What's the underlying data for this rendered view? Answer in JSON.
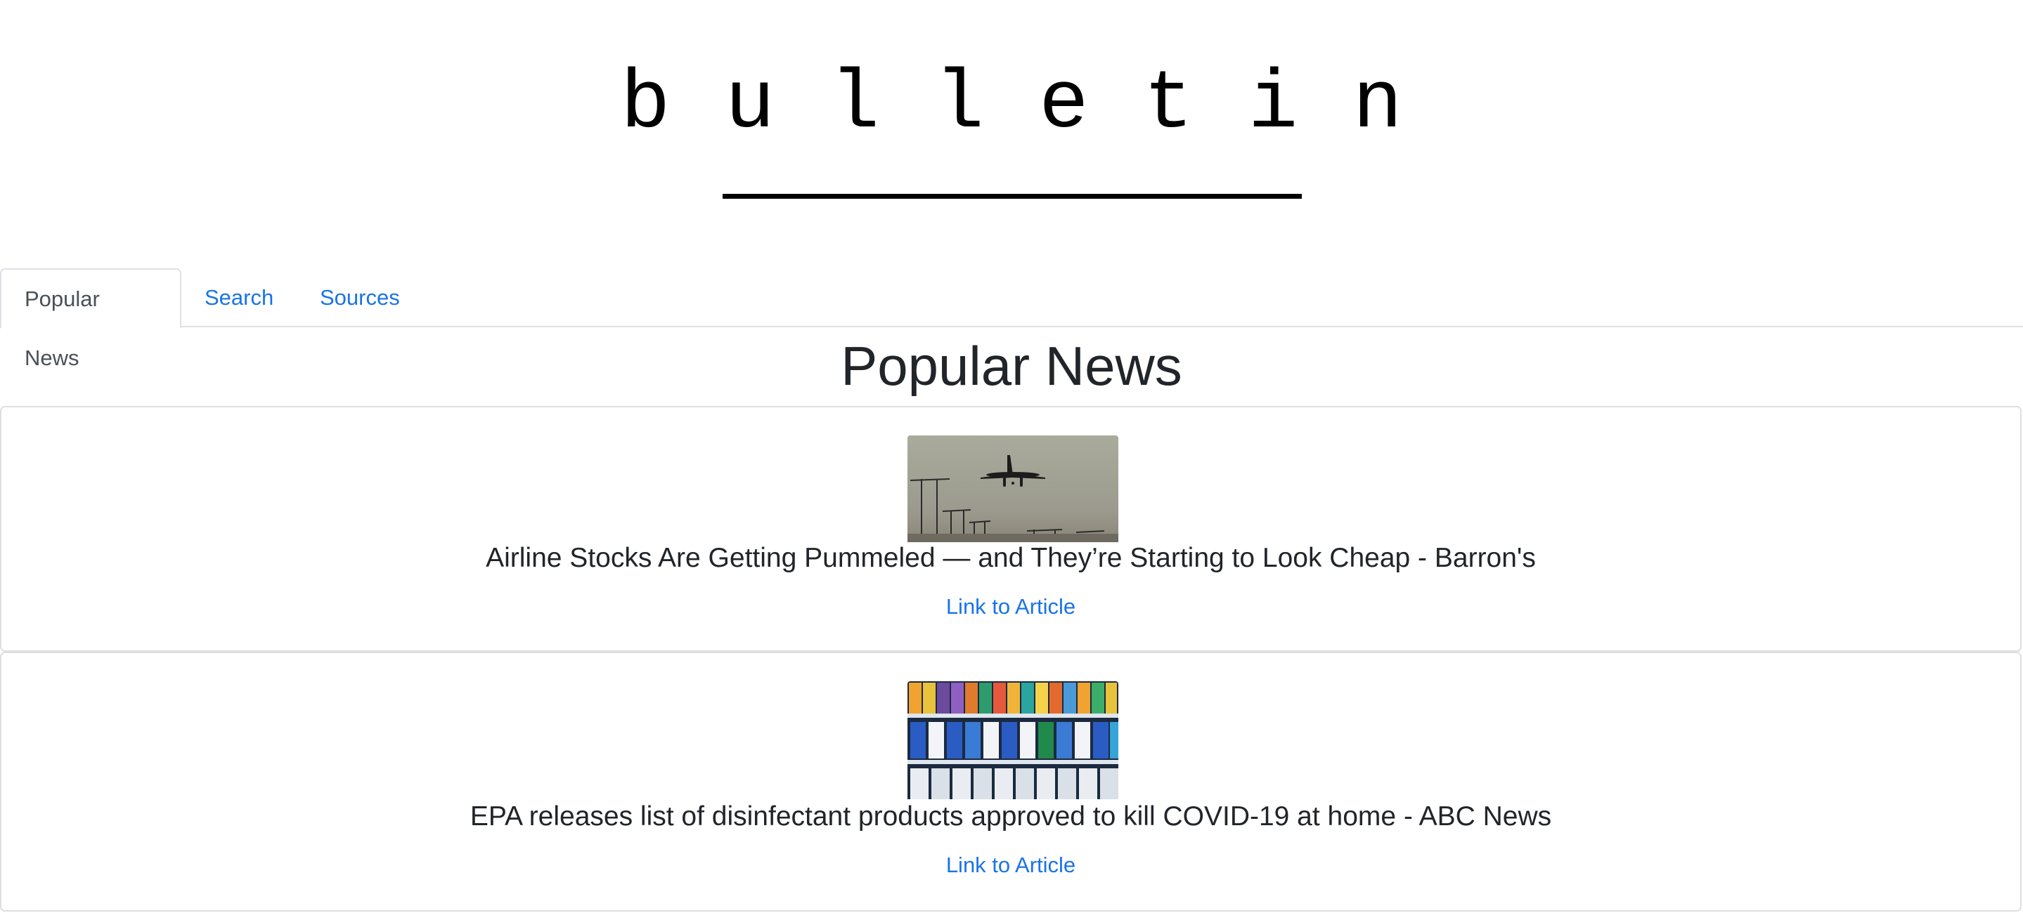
{
  "brand": {
    "title": "bulletin"
  },
  "tabs": [
    {
      "label": "Popular News",
      "active": true
    },
    {
      "label": "Search",
      "active": false
    },
    {
      "label": "Sources",
      "active": false
    }
  ],
  "main": {
    "heading": "Popular News",
    "articles": [
      {
        "title": "Airline Stocks Are Getting Pummeled — and They’re Starting to Look Cheap - Barron's",
        "link_label": "Link to Article",
        "image": "airplane-landing-photo"
      },
      {
        "title": "EPA releases list of disinfectant products approved to kill COVID-19 at home - ABC News",
        "link_label": "Link to Article",
        "image": "disinfectant-shelf-photo"
      }
    ]
  },
  "colors": {
    "link": "#1a73e8",
    "text": "#212529",
    "border": "#dee2e6"
  }
}
